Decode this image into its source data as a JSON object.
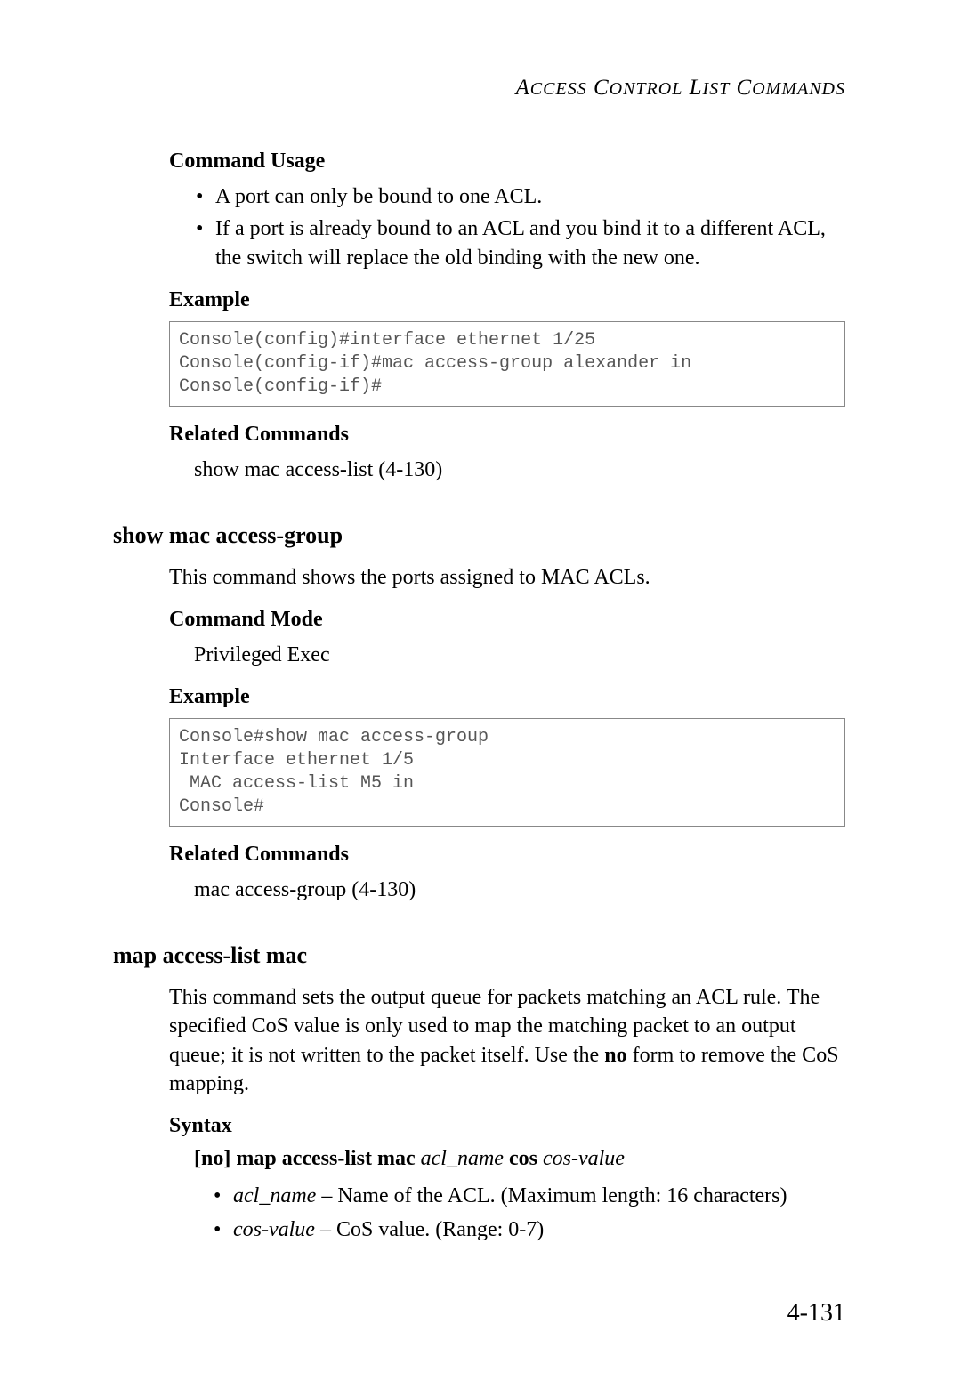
{
  "header": "ACCESS CONTROL LIST COMMANDS",
  "section1": {
    "usage_heading": "Command Usage",
    "usage_bullet1": "A port can only be bound to one ACL.",
    "usage_bullet2": "If a port is already bound to an ACL and you bind it to a different ACL, the switch will replace the old binding with the new one.",
    "example_heading": "Example",
    "example_code": "Console(config)#interface ethernet 1/25\nConsole(config-if)#mac access-group alexander in\nConsole(config-if)#",
    "related_heading": "Related Commands",
    "related_text": "show mac access-list (4-130)"
  },
  "section2": {
    "command_heading": "show mac access-group",
    "description": "This command shows the ports assigned to MAC ACLs.",
    "mode_heading": "Command Mode",
    "mode_text": "Privileged Exec",
    "example_heading": "Example",
    "example_code": "Console#show mac access-group\nInterface ethernet 1/5\n MAC access-list M5 in\nConsole#",
    "related_heading": "Related Commands",
    "related_text": "mac access-group (4-130)"
  },
  "section3": {
    "command_heading": "map access-list mac",
    "description_part1": "This command sets the output queue for packets matching an ACL rule. The specified CoS value is only used to map the matching packet to an output queue; it is not written to the packet itself. Use the ",
    "description_bold": "no",
    "description_part2": " form to remove the CoS mapping.",
    "syntax_heading": "Syntax",
    "syntax_bracket_open": "[",
    "syntax_no": "no",
    "syntax_bracket_close": "] ",
    "syntax_cmd": "map access-list mac",
    "syntax_arg1": "acl_name",
    "syntax_cos": "cos",
    "syntax_arg2": "cos-value",
    "param1_name": "acl_name",
    "param1_desc": " – Name of the ACL. (Maximum length: 16 characters)",
    "param2_name": "cos-value",
    "param2_desc": " – CoS value. (Range: 0-7)"
  },
  "page_number": "4-131"
}
